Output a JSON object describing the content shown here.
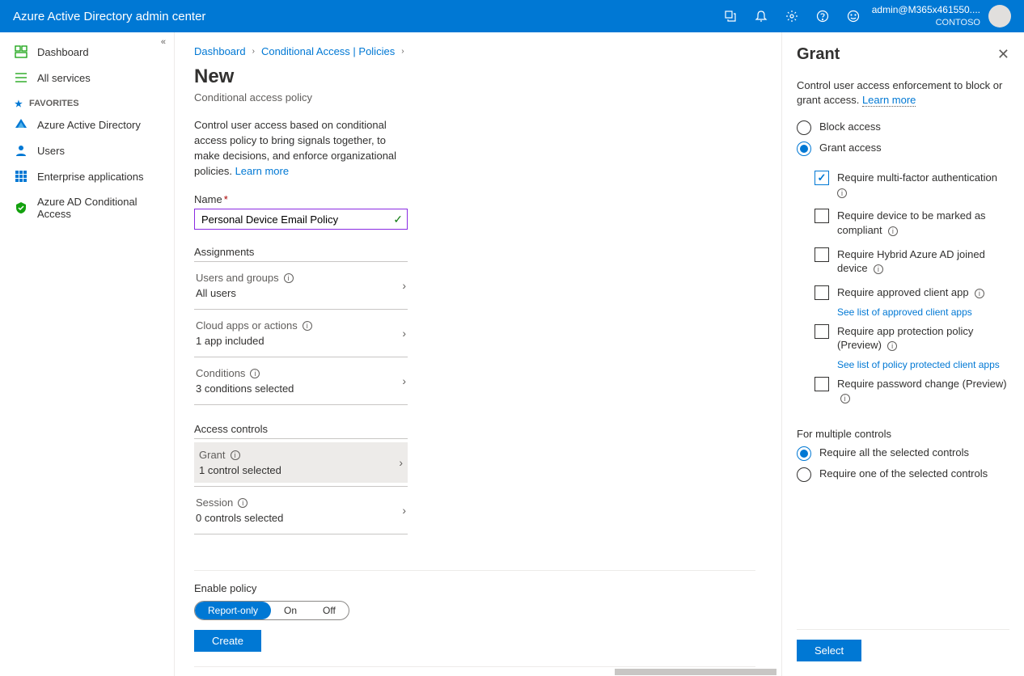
{
  "header": {
    "title": "Azure Active Directory admin center",
    "user": "admin@M365x461550....",
    "tenant": "CONTOSO"
  },
  "sidebar": {
    "dashboard": "Dashboard",
    "all_services": "All services",
    "favorites_label": "FAVORITES",
    "items": [
      {
        "label": "Azure Active Directory"
      },
      {
        "label": "Users"
      },
      {
        "label": "Enterprise applications"
      },
      {
        "label": "Azure AD Conditional Access"
      }
    ]
  },
  "breadcrumb": {
    "a": "Dashboard",
    "b": "Conditional Access | Policies"
  },
  "page": {
    "title": "New",
    "subtitle": "Conditional access policy",
    "description": "Control user access based on conditional access policy to bring signals together, to make decisions, and enforce organizational policies. ",
    "learn_more": "Learn more",
    "name_label": "Name",
    "name_value": "Personal Device Email Policy",
    "assignments_label": "Assignments",
    "assignments": [
      {
        "label": "Users and groups",
        "value": "All users"
      },
      {
        "label": "Cloud apps or actions",
        "value": "1 app included"
      },
      {
        "label": "Conditions",
        "value": "3 conditions selected"
      }
    ],
    "access_controls_label": "Access controls",
    "access_controls": [
      {
        "label": "Grant",
        "value": "1 control selected",
        "active": true
      },
      {
        "label": "Session",
        "value": "0 controls selected",
        "active": false
      }
    ],
    "enable_policy_label": "Enable policy",
    "enable_options": [
      "Report-only",
      "On",
      "Off"
    ],
    "enable_selected": "Report-only",
    "create_button": "Create"
  },
  "panel": {
    "title": "Grant",
    "description": "Control user access enforcement to block or grant access. ",
    "learn_more": "Learn more",
    "radio_block": "Block access",
    "radio_grant": "Grant access",
    "checks": [
      {
        "label": "Require multi-factor authentication",
        "checked": true,
        "info": true
      },
      {
        "label": "Require device to be marked as compliant",
        "checked": false,
        "info": true
      },
      {
        "label": "Require Hybrid Azure AD joined device",
        "checked": false,
        "info": true
      },
      {
        "label": "Require approved client app",
        "checked": false,
        "info": true,
        "sublink": "See list of approved client apps"
      },
      {
        "label": "Require app protection policy (Preview)",
        "checked": false,
        "info": true,
        "sublink": "See list of policy protected client apps"
      },
      {
        "label": "Require password change (Preview)",
        "checked": false,
        "info": true
      }
    ],
    "multiple_label": "For multiple controls",
    "multi_all": "Require all the selected controls",
    "multi_one": "Require one of the selected controls",
    "select_button": "Select"
  }
}
